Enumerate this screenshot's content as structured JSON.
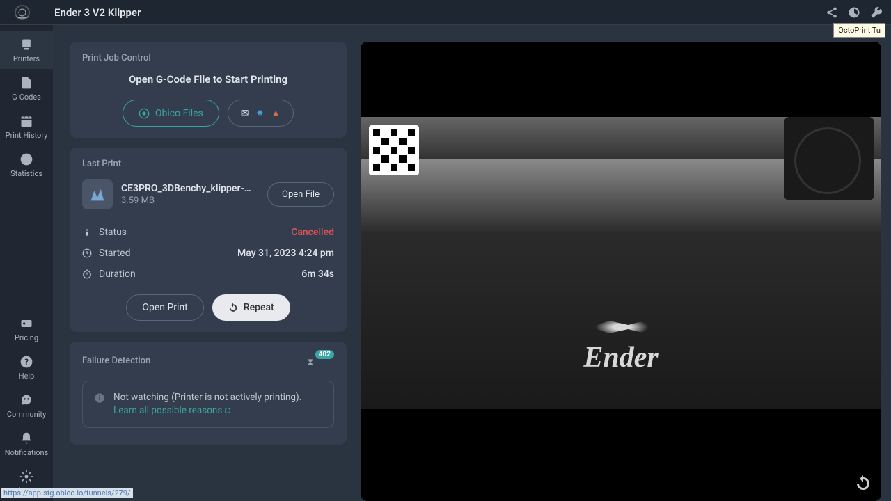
{
  "header": {
    "title": "Ender 3 V2 Klipper",
    "tooltip": "OctoPrint Tu"
  },
  "sidebar": {
    "top": [
      {
        "label": "Printers"
      },
      {
        "label": "G-Codes"
      },
      {
        "label": "Print History"
      },
      {
        "label": "Statistics"
      }
    ],
    "bottom": [
      {
        "label": "Pricing"
      },
      {
        "label": "Help"
      },
      {
        "label": "Community"
      },
      {
        "label": "Notifications"
      },
      {
        "label": "Preferences"
      }
    ]
  },
  "print_job": {
    "card_title": "Print Job Control",
    "open_prompt": "Open G-Code File to Start Printing",
    "obico_files": "Obico Files"
  },
  "last_print": {
    "card_title": "Last Print",
    "filename": "CE3PRO_3DBenchy_klipper-…",
    "filesize": "3.59 MB",
    "open_file": "Open File",
    "status_label": "Status",
    "status_value": "Cancelled",
    "started_label": "Started",
    "started_value": "May 31, 2023 4:24 pm",
    "duration_label": "Duration",
    "duration_value": "6m 34s",
    "open_print": "Open Print",
    "repeat": "Repeat"
  },
  "failure": {
    "card_title": "Failure Detection",
    "badge": "402",
    "not_watching": "Not watching (Printer is not actively printing).",
    "learn_link": "Learn all possible reasons"
  },
  "camera": {
    "brand": "Ender"
  },
  "status_url": "https://app-stg.obico.io/tunnels/279/"
}
